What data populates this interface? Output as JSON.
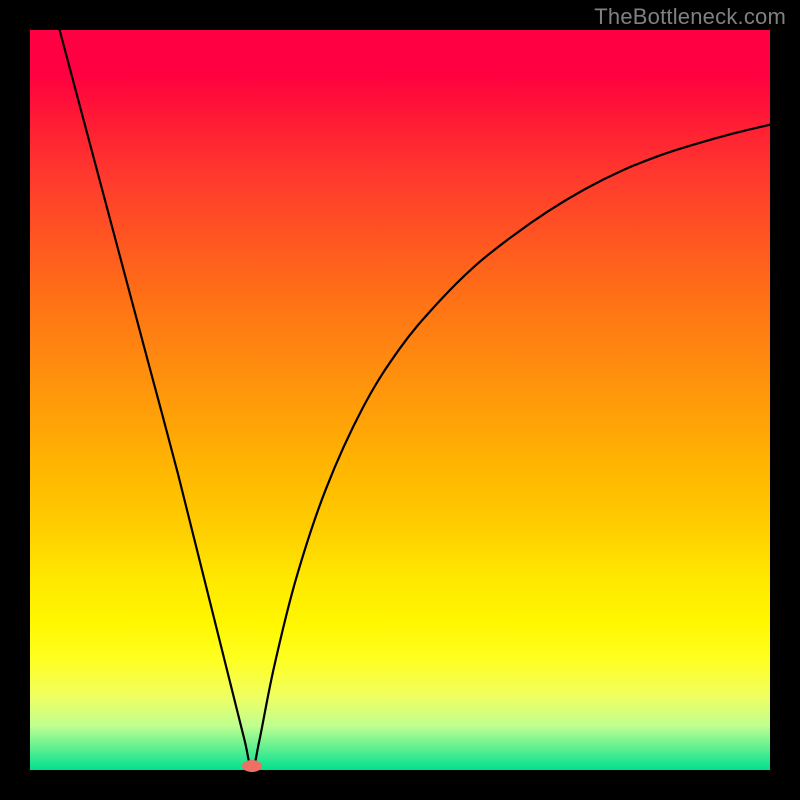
{
  "watermark": "TheBottleneck.com",
  "chart_data": {
    "type": "line",
    "title": "",
    "xlabel": "",
    "ylabel": "",
    "xlim": [
      0,
      100
    ],
    "ylim": [
      0,
      100
    ],
    "grid": false,
    "series": [
      {
        "name": "bottleneck-curve",
        "x": [
          4,
          8,
          12,
          16,
          20,
          24,
          27,
          29,
          30,
          31,
          33,
          36,
          40,
          45,
          50,
          55,
          60,
          65,
          70,
          75,
          80,
          85,
          90,
          95,
          100
        ],
        "values": [
          100,
          85,
          70,
          55,
          40,
          24,
          12,
          4,
          0,
          4,
          14,
          26,
          38,
          49,
          57,
          63,
          68,
          72,
          75.5,
          78.5,
          81,
          83,
          84.6,
          86,
          87.2
        ]
      }
    ],
    "annotations": [
      {
        "type": "marker",
        "x": 30,
        "y": 0.5,
        "color": "#ec7063",
        "name": "min-point"
      }
    ],
    "colors": {
      "curve": "#000000",
      "marker": "#ec7063",
      "background_top": "#ff0044",
      "background_bottom": "#00e090"
    }
  }
}
